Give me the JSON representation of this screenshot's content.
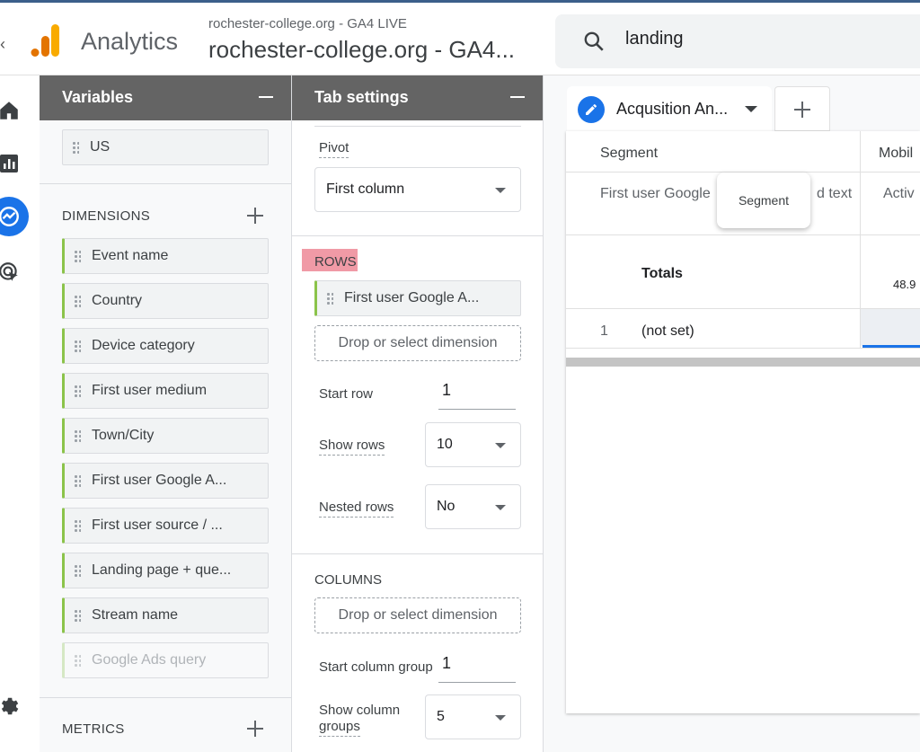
{
  "header": {
    "back_char": "‹",
    "app_title": "Analytics",
    "account_sub": "rochester-college.org - GA4 LIVE",
    "property_title": "rochester-college.org - GA4...",
    "search_value": "landing",
    "logo_colors": [
      "#f9ab00",
      "#e37400"
    ]
  },
  "left_nav": {
    "icons": [
      "home-icon",
      "reports-icon",
      "explore-icon",
      "advertising-icon",
      "settings-icon"
    ],
    "active_color": "#1a73e8"
  },
  "variables_panel": {
    "title": "Variables",
    "segment_chip": "US",
    "dimensions_label": "DIMENSIONS",
    "dimensions": [
      "Event name",
      "Country",
      "Device category",
      "First user medium",
      "Town/City",
      "First user Google A...",
      "First user source / ...",
      "Landing page + que...",
      "Stream name",
      "Google Ads query"
    ],
    "metrics_label": "METRICS"
  },
  "tab_settings": {
    "title": "Tab settings",
    "pivot_label": "Pivot",
    "pivot_value": "First column",
    "rows_label": "ROWS",
    "rows_dimension": "First user Google A...",
    "drop_rows": "Drop or select dimension",
    "start_row_label": "Start row",
    "start_row_value": "1",
    "show_rows_label": "Show rows",
    "show_rows_value": "10",
    "nested_rows_label": "Nested rows",
    "nested_rows_value": "No",
    "columns_label": "COLUMNS",
    "drop_columns": "Drop or select dimension",
    "start_column_group_label": "Start column group",
    "start_column_group_value": "1",
    "show_column_groups_label_1": "Show column",
    "show_column_groups_label_2": "groups",
    "show_column_groups_value": "5"
  },
  "canvas": {
    "tab_label": "Acqusition An...",
    "table": {
      "col_segment": "Segment",
      "col_mobile": "Mobil",
      "row_dimension_header": "First user Google",
      "row_dimension_header_tail": "d text",
      "row_metric_header": "Activ",
      "totals_label": "Totals",
      "totals_value": "48.9",
      "row_1_index": "1",
      "row_1_value": "(not set)"
    },
    "tooltip": "Segment"
  }
}
